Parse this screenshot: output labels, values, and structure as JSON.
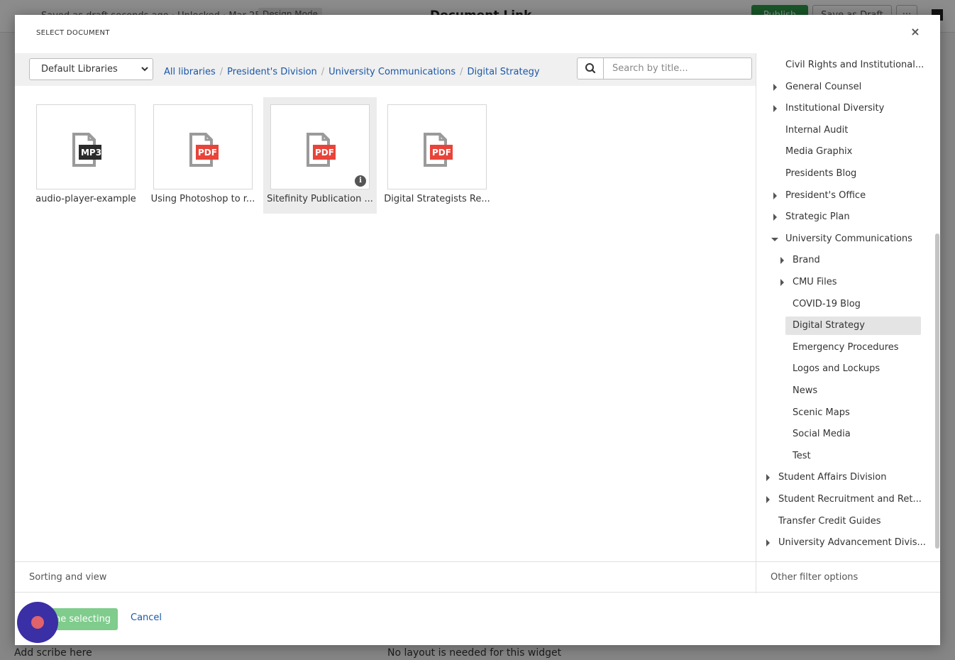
{
  "background": {
    "status_text": "Saved as draft seconds ago · Unlocked · Mar 25",
    "mode_badge": "Design Mode",
    "page_title": "Document Link",
    "publish_label": "Publish",
    "save_draft_label": "Save as Draft",
    "more_label": "···",
    "bottom_left_text": "Add scribe here",
    "bottom_mid_text": "No layout is needed for this widget"
  },
  "modal": {
    "title": "SELECT DOCUMENT",
    "close_label": "×"
  },
  "toolbar": {
    "library_select": "Default Libraries",
    "breadcrumb": [
      "All libraries",
      "President's Division",
      "University Communications",
      "Digital Strategy"
    ],
    "search_placeholder": "Search by title..."
  },
  "documents": [
    {
      "label": "audio-player-example",
      "badge": "MP3",
      "badge_color": "#2b2b2b",
      "selected": false
    },
    {
      "label": "Using Photoshop to r...",
      "badge": "PDF",
      "badge_color": "#e8443a",
      "selected": false
    },
    {
      "label": "Sitefinity Publication ...",
      "badge": "PDF",
      "badge_color": "#e8443a",
      "selected": true
    },
    {
      "label": "Digital Strategists Re...",
      "badge": "PDF",
      "badge_color": "#e8443a",
      "selected": false
    }
  ],
  "tree": [
    {
      "label": "Civil Rights and Institutional...",
      "level": 1,
      "toggle": "none",
      "active": false
    },
    {
      "label": "General Counsel",
      "level": 1,
      "toggle": "collapsed",
      "active": false
    },
    {
      "label": "Institutional Diversity",
      "level": 1,
      "toggle": "collapsed",
      "active": false
    },
    {
      "label": "Internal Audit",
      "level": 1,
      "toggle": "none",
      "active": false
    },
    {
      "label": "Media Graphix",
      "level": 1,
      "toggle": "none",
      "active": false
    },
    {
      "label": "Presidents Blog",
      "level": 1,
      "toggle": "none",
      "active": false
    },
    {
      "label": "President's Office",
      "level": 1,
      "toggle": "collapsed",
      "active": false
    },
    {
      "label": "Strategic Plan",
      "level": 1,
      "toggle": "collapsed",
      "active": false
    },
    {
      "label": "University Communications",
      "level": 1,
      "toggle": "expanded",
      "active": false
    },
    {
      "label": "Brand",
      "level": 2,
      "toggle": "collapsed",
      "active": false
    },
    {
      "label": "CMU Files",
      "level": 2,
      "toggle": "collapsed",
      "active": false
    },
    {
      "label": "COVID-19 Blog",
      "level": 2,
      "toggle": "none",
      "active": false
    },
    {
      "label": "Digital Strategy",
      "level": 2,
      "toggle": "none",
      "active": true
    },
    {
      "label": "Emergency Procedures",
      "level": 2,
      "toggle": "none",
      "active": false
    },
    {
      "label": "Logos and Lockups",
      "level": 2,
      "toggle": "none",
      "active": false
    },
    {
      "label": "News",
      "level": 2,
      "toggle": "none",
      "active": false
    },
    {
      "label": "Scenic Maps",
      "level": 2,
      "toggle": "none",
      "active": false
    },
    {
      "label": "Social Media",
      "level": 2,
      "toggle": "none",
      "active": false
    },
    {
      "label": "Test",
      "level": 2,
      "toggle": "none",
      "active": false
    },
    {
      "label": "Student Affairs Division",
      "level": 0,
      "toggle": "collapsed",
      "active": false
    },
    {
      "label": "Student Recruitment and Ret...",
      "level": 0,
      "toggle": "collapsed",
      "active": false
    },
    {
      "label": "Transfer Credit Guides",
      "level": 0,
      "toggle": "none",
      "active": false
    },
    {
      "label": "University Advancement Divis...",
      "level": 0,
      "toggle": "collapsed",
      "active": false
    }
  ],
  "footer": {
    "sorting_label": "Sorting and view",
    "other_filters_label": "Other filter options",
    "done_label": "Done selecting",
    "cancel_label": "Cancel"
  },
  "colors": {
    "link": "#1a57a8",
    "done_button": "#7fcc8c",
    "pdf_badge": "#e8443a",
    "mp3_badge": "#2b2b2b",
    "recorder": "#3a2fa5"
  }
}
